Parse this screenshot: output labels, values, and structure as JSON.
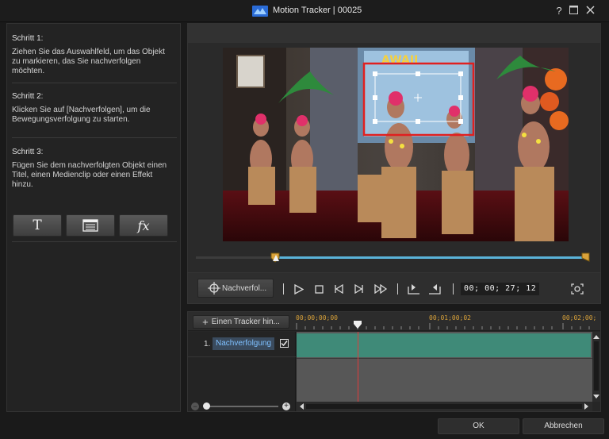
{
  "window": {
    "title": "Motion Tracker | 00025",
    "help_label": "?"
  },
  "steps": [
    {
      "title": "Schritt 1:",
      "text": "Ziehen Sie das Auswahlfeld, um das Objekt zu markieren, das Sie nachverfolgen möchten."
    },
    {
      "title": "Schritt 2:",
      "text": "Klicken Sie auf [Nachverfolgen], um die Bewegungsverfolgung zu starten."
    },
    {
      "title": "Schritt 3:",
      "text": "Fügen Sie dem nachverfolgten Objekt einen Titel, einen Medienclip oder einen Effekt hinzu."
    }
  ],
  "tools": {
    "title_label": "T",
    "fx_label": "fx",
    "icons": [
      "title-icon",
      "media-clip-icon",
      "effect-icon"
    ]
  },
  "controls": {
    "track_button_label": "Nachverfol...",
    "timecode": "00; 00; 27; 12",
    "icons": [
      "play-icon",
      "stop-icon",
      "prev-frame-icon",
      "next-frame-icon",
      "fast-forward-icon",
      "mark-in-icon",
      "mark-out-icon",
      "snapshot-icon"
    ]
  },
  "timeline": {
    "add_tracker_label": "Einen Tracker hin...",
    "ruler": [
      "00;00;00;00",
      "00;01;00;02",
      "00;02;00;"
    ],
    "tracks": [
      {
        "number": "1.",
        "name": "Nachverfolgung",
        "enabled": true
      }
    ],
    "playhead_fraction": 0.205
  },
  "footer": {
    "ok_label": "OK",
    "cancel_label": "Abbrechen"
  },
  "colors": {
    "tracking_box": "#e02020",
    "clip": "#3f8a78",
    "seek_range": "#5ab3d9",
    "ruler_text": "#d9a23a"
  }
}
